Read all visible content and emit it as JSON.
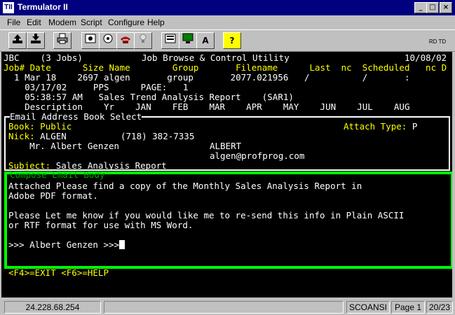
{
  "window": {
    "icon_text": "TII",
    "title": "Termulator II",
    "minimize_glyph": "_",
    "maximize_glyph": "□",
    "close_glyph": "×"
  },
  "menu": [
    "File",
    "Edit",
    "Modem",
    "Script",
    "Configure",
    "Help"
  ],
  "toolbar": {
    "a_glyph": "A",
    "help_glyph": "?",
    "rd": "RD",
    "td": "TD"
  },
  "terminal": {
    "header_left": "JBC    (3 Jobs)",
    "header_center": "Job Browse & Control Utility",
    "header_right": "10/08/02",
    "columns_line": "Job# Date      Size Name        Group       Filename      Last  nc  Scheduled   nc D",
    "job_line1": "  1 Mar 18    2697 algen       group       2077.021956   /          /       :",
    "job_line2": "    03/17/02     PPS      PAGE:   1",
    "job_line3": "    05:38:57 AM   Sales Trend Analysis Report    (SAR1)",
    "job_line4": "    Description    Yr    JAN    FEB    MAR    APR    MAY    JUN    JUL    AUG",
    "email_box_title": "Email Address Book Select",
    "book_label": "Book:",
    "book_value": "Public",
    "attach_label": "Attach Type:",
    "attach_value": "P",
    "nick_label": "Nick:",
    "nick_value": "ALGEN",
    "phone": "(718) 382-7335",
    "full_name": "    Mr. Albert Genzen",
    "first_name": "ALBERT",
    "email": "algen@profprog.com",
    "subject_label": "Subject:",
    "subject_value": "Sales Analysis Report",
    "compose_title": "Compose Email Body",
    "body_line1": "Attached Please find a copy of the Monthly Sales Analysis Report in",
    "body_line2": "Adobe PDF format.",
    "body_line3": "",
    "body_line4": "Please Let me know if you would like me to re-send this info in Plain ASCII",
    "body_line5": "or RTF format for use with MS Word.",
    "body_line6": "",
    "body_line7": ">>> Albert Genzen >>>",
    "footer_keys": "<F4>=EXIT <F6>=HELP"
  },
  "status": {
    "ip": "24.228.68.254",
    "emulation": "SCOANSI",
    "page": "Page 1",
    "position": "20/23"
  }
}
